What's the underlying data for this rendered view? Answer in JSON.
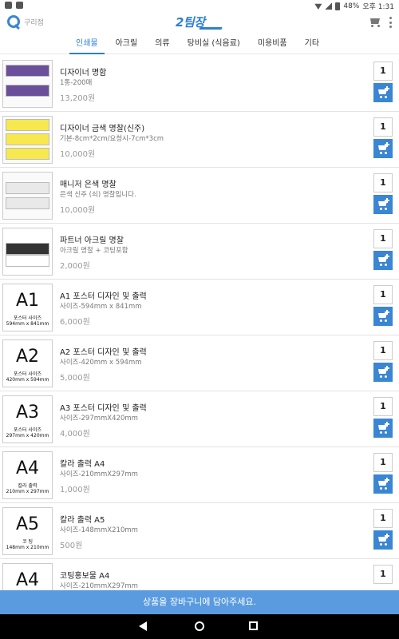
{
  "status_bar": {
    "battery": "48%",
    "time": "오후 1:31"
  },
  "header": {
    "search_label": "구리점",
    "logo_text": "2팀장"
  },
  "tabs": [
    {
      "label": "인쇄물",
      "active": true
    },
    {
      "label": "아크릴",
      "active": false
    },
    {
      "label": "의류",
      "active": false
    },
    {
      "label": "탕비실 (식음료)",
      "active": false
    },
    {
      "label": "미용비품",
      "active": false
    },
    {
      "label": "기타",
      "active": false
    }
  ],
  "items": [
    {
      "title": "디자이너 명함",
      "subtitle": "1통-200매",
      "price": "13,200원",
      "qty": "1",
      "thumb_type": "purple-cards"
    },
    {
      "title": "디자이너 금색 명찰(신주)",
      "subtitle": "기본-8cm*2cm/요청시-7cm*3cm",
      "price": "10,000원",
      "qty": "1",
      "thumb_type": "yellow-cards"
    },
    {
      "title": "매니저 은색 명찰",
      "subtitle": "은색 신주 (쇠) 명찰입니다.",
      "price": "10,000원",
      "qty": "1",
      "thumb_type": "silver-cards"
    },
    {
      "title": "파트너 아크릴 명찰",
      "subtitle": "아크릴 명찰 + 코팅포함",
      "price": "2,000원",
      "qty": "1",
      "thumb_type": "dark-card"
    },
    {
      "title": "A1 포스터 디자인 및 출력",
      "subtitle": "사이즈-594mm x 841mm",
      "price": "6,000원",
      "qty": "1",
      "thumb_big": "A1",
      "thumb_small": "포스터 사이즈",
      "thumb_small2": "594mm x 841mm"
    },
    {
      "title": "A2 포스터 디자인 및 출력",
      "subtitle": "사이즈-420mm x 594mm",
      "price": "5,000원",
      "qty": "1",
      "thumb_big": "A2",
      "thumb_small": "포스터 사이즈",
      "thumb_small2": "420mm x 594mm"
    },
    {
      "title": "A3 포스터 디자인 및 출력",
      "subtitle": "사이즈-297mmX420mm",
      "price": "4,000원",
      "qty": "1",
      "thumb_big": "A3",
      "thumb_small": "포스터 사이즈",
      "thumb_small2": "297mm x 420mm"
    },
    {
      "title": "칼라 출력 A4",
      "subtitle": "사이즈-210mmX297mm",
      "price": "1,000원",
      "qty": "1",
      "thumb_big": "A4",
      "thumb_small": "칼라 출력",
      "thumb_small2": "210mm x 297mm"
    },
    {
      "title": "칼라 출력 A5",
      "subtitle": "사이즈-148mmX210mm",
      "price": "500원",
      "qty": "1",
      "thumb_big": "A5",
      "thumb_small": "코 팅",
      "thumb_small2": "148mm x 210mm"
    },
    {
      "title": "코팅홍보물 A4",
      "subtitle": "사이즈-210mmX297mm",
      "price": "",
      "qty": "1",
      "thumb_big": "A4",
      "thumb_small": "",
      "thumb_small2": ""
    }
  ],
  "banner": "상품을 장바구니에 담아주세요.",
  "colors": {
    "accent": "#3a86d4",
    "banner": "#5a9be0"
  }
}
